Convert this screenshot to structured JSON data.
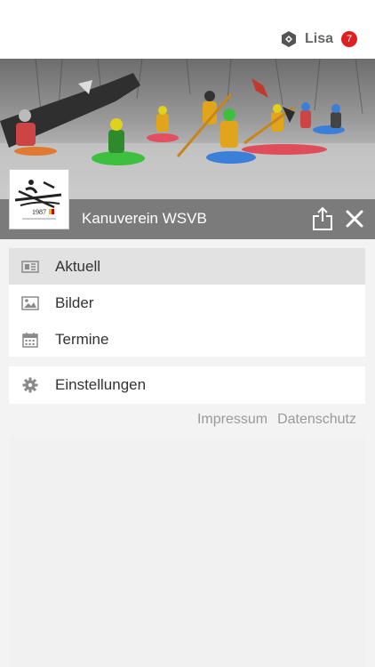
{
  "header": {
    "user_name": "Lisa",
    "notification_count": "7",
    "user_icon": "hexagon-logo-icon"
  },
  "club": {
    "name": "Kanuverein WSVB",
    "share_icon": "share-icon",
    "close_icon": "close-icon"
  },
  "menu": {
    "primary": [
      {
        "label": "Aktuell",
        "icon": "newspaper-icon",
        "active": true
      },
      {
        "label": "Bilder",
        "icon": "image-icon",
        "active": false
      },
      {
        "label": "Termine",
        "icon": "calendar-icon",
        "active": false
      }
    ],
    "secondary": [
      {
        "label": "Einstellungen",
        "icon": "gear-icon",
        "active": false
      }
    ]
  },
  "footer": {
    "impressum": "Impressum",
    "datenschutz": "Datenschutz"
  },
  "colors": {
    "badge": "#e02020",
    "club_bar": "#7b7b7b",
    "active_item": "#e2e2e2"
  }
}
